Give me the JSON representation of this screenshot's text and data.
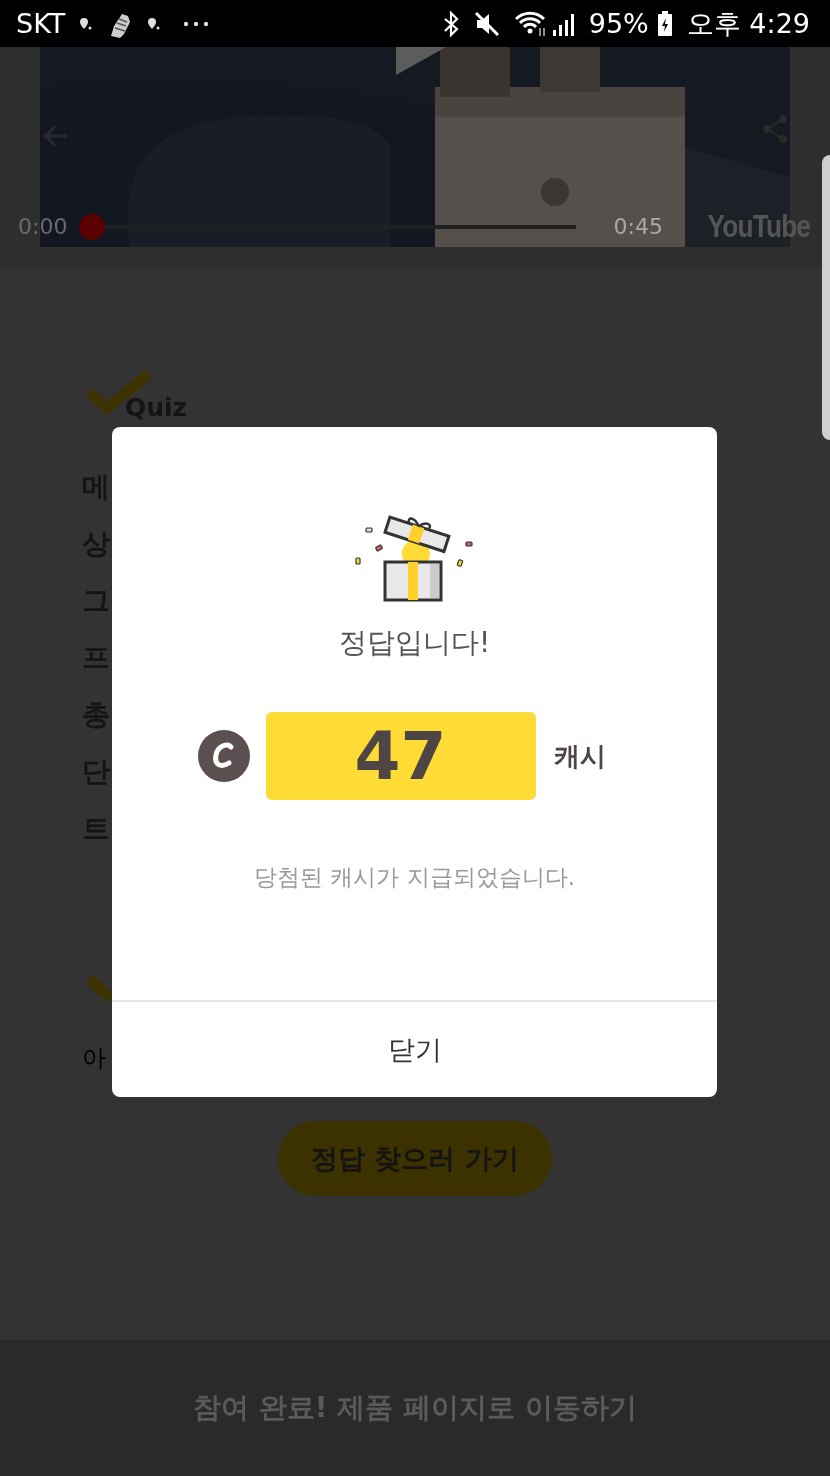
{
  "status_bar": {
    "carrier": "SKT",
    "battery": "95%",
    "time": "오후 4:29"
  },
  "video": {
    "current_time": "0:00",
    "duration": "0:45",
    "level": 0,
    "logo": "YouTube"
  },
  "quiz": {
    "heading": "Quiz",
    "question_lines": [
      {
        "start": "메"
      },
      {
        "start": "상"
      },
      {
        "start": "그"
      },
      {
        "start": "프"
      },
      {
        "start": "총"
      },
      {
        "start": "단"
      },
      {
        "start": "트"
      }
    ],
    "hint": "아",
    "find_button": "정답 찾으러 가기"
  },
  "bottom_bar": {
    "label": "참여 완료! 제품 페이지로 이동하기"
  },
  "dialog": {
    "title": "정답입니다!",
    "amount": "47",
    "unit": "캐시",
    "message": "당첨된 캐시가 지급되었습니다.",
    "close_button": "닫기"
  }
}
